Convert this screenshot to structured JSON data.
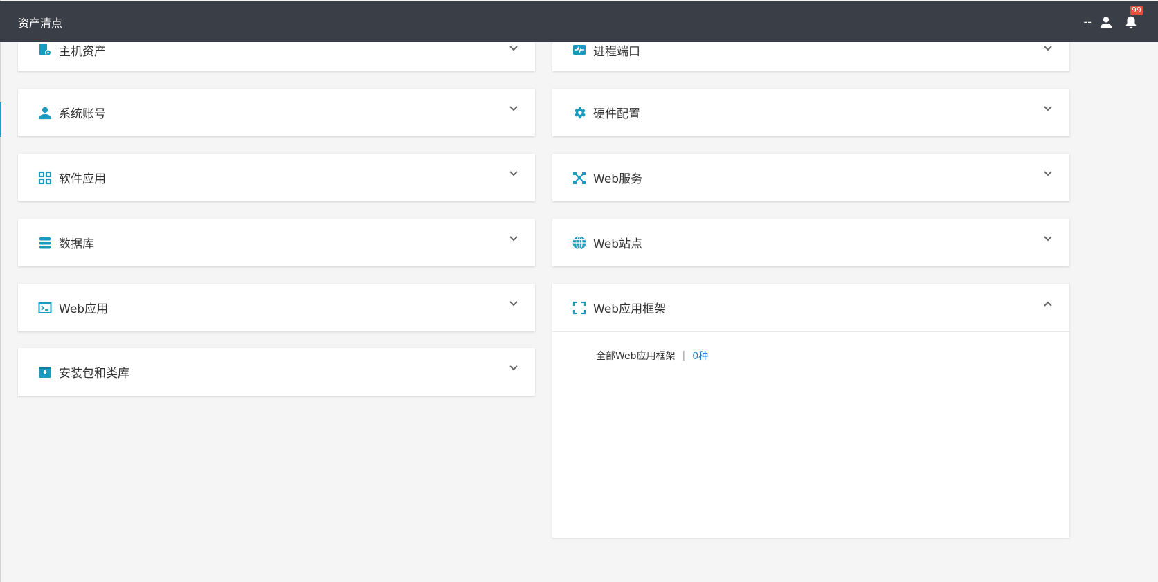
{
  "header": {
    "title": "资产清点",
    "user_text": "--",
    "notification_count": "99"
  },
  "cards": {
    "host_assets": {
      "label": "主机资产",
      "icon": "host-gear-icon"
    },
    "process_ports": {
      "label": "进程端口",
      "icon": "pulse-icon"
    },
    "system_accounts": {
      "label": "系统账号",
      "icon": "user-icon"
    },
    "hardware_config": {
      "label": "硬件配置",
      "icon": "gear-icon"
    },
    "software_apps": {
      "label": "软件应用",
      "icon": "grid-icon"
    },
    "web_services": {
      "label": "Web服务",
      "icon": "network-icon"
    },
    "database": {
      "label": "数据库",
      "icon": "database-icon"
    },
    "web_sites": {
      "label": "Web站点",
      "icon": "globe-icon"
    },
    "web_apps": {
      "label": "Web应用",
      "icon": "terminal-icon"
    },
    "web_frameworks": {
      "label": "Web应用框架",
      "icon": "frame-icon",
      "expanded": true,
      "summary_label": "全部Web应用框架",
      "separator": "|",
      "count_text": "0种"
    },
    "packages": {
      "label": "安装包和类库",
      "icon": "package-icon"
    }
  },
  "colors": {
    "accent": "#1a9bbd",
    "topbar": "#3a3f47",
    "link": "#1e7fd0",
    "badge": "#e04e3c"
  }
}
